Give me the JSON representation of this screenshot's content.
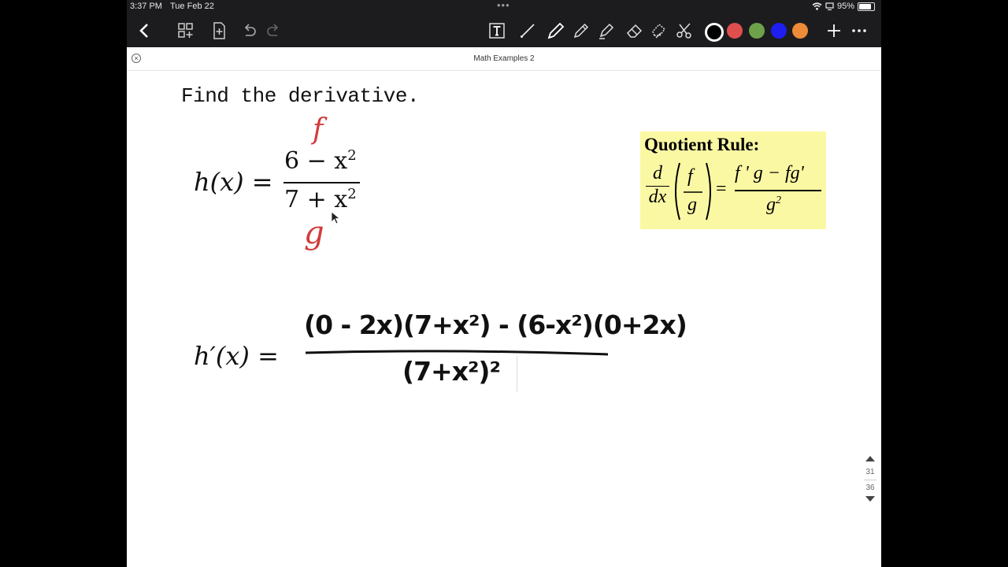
{
  "status": {
    "time": "3:37 PM",
    "date": "Tue Feb 22",
    "battery": "95%",
    "battery_level": 0.95
  },
  "toolbar": {
    "colors": [
      "#000000",
      "#e04e4e",
      "#6ea24a",
      "#1e1ef0",
      "#ee8b38"
    ],
    "selected_color": "#000000",
    "icons": [
      "back-icon",
      "thumbnails-icon",
      "add-page-icon",
      "undo-icon",
      "redo-icon",
      "text-tool-icon",
      "line-tool-icon",
      "pen-icon",
      "pencil-icon",
      "highlighter-icon",
      "eraser-icon",
      "lasso-icon",
      "scissors-icon",
      "plus-icon",
      "more-icon"
    ]
  },
  "document": {
    "title": "Math Examples 2"
  },
  "page": {
    "prompt": "Find the derivative.",
    "h_lhs": "h(x) =",
    "h_num": "6 − x",
    "h_num_exp": "2",
    "h_den": "7 + x",
    "h_den_exp": "2",
    "label_f": "f",
    "label_g": "g",
    "hp_lhs": "h′(x) =",
    "hp_num": "(0 - 2x)(7+x²) - (6-x²)(0+2x)",
    "hp_den": "(7+x²)²"
  },
  "quotient_rule": {
    "heading": "Quotient Rule:",
    "d": "d",
    "dx": "dx",
    "f": "f",
    "g": "g",
    "eq": "=",
    "rhs_num": "f ' g − fg'",
    "rhs_den": "g",
    "rhs_den_exp": "2"
  },
  "pager": {
    "current": "31",
    "total": "36"
  }
}
